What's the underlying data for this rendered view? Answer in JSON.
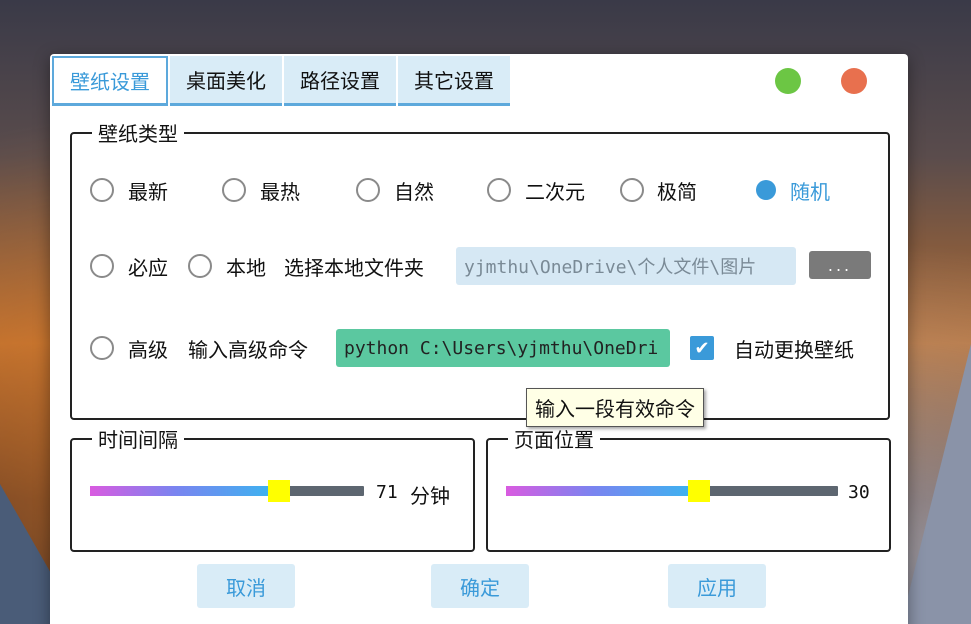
{
  "tabs": [
    {
      "label": "壁纸设置",
      "active": true
    },
    {
      "label": "桌面美化",
      "active": false
    },
    {
      "label": "路径设置",
      "active": false
    },
    {
      "label": "其它设置",
      "active": false
    }
  ],
  "window_controls": {
    "minimize_color": "#6cc644",
    "close_color": "#e8704e"
  },
  "wallpaper_type": {
    "title": "壁纸类型",
    "options": [
      "最新",
      "最热",
      "自然",
      "二次元",
      "极简",
      "随机",
      "必应",
      "本地",
      "高级"
    ],
    "selected": "随机",
    "local_folder_label": "选择本地文件夹",
    "local_folder_value": "yjmthu\\OneDrive\\个人文件\\图片",
    "browse_label": "...",
    "advanced_label": "输入高级命令",
    "advanced_value": "python C:\\Users\\yjmthu\\OneDri",
    "auto_change_label": "自动更换壁纸",
    "auto_change_checked": true,
    "tooltip": "输入一段有效命令"
  },
  "interval": {
    "title": "时间间隔",
    "value": "71",
    "unit": "分钟",
    "fraction": 0.69
  },
  "page_position": {
    "title": "页面位置",
    "value": "30",
    "fraction": 0.58
  },
  "buttons": {
    "cancel": "取消",
    "ok": "确定",
    "apply": "应用"
  },
  "colors": {
    "accent": "#3a9ad9",
    "tab_bg": "#d9ecf7",
    "command_bg": "#5bc8a0",
    "thumb": "#ffff00"
  }
}
